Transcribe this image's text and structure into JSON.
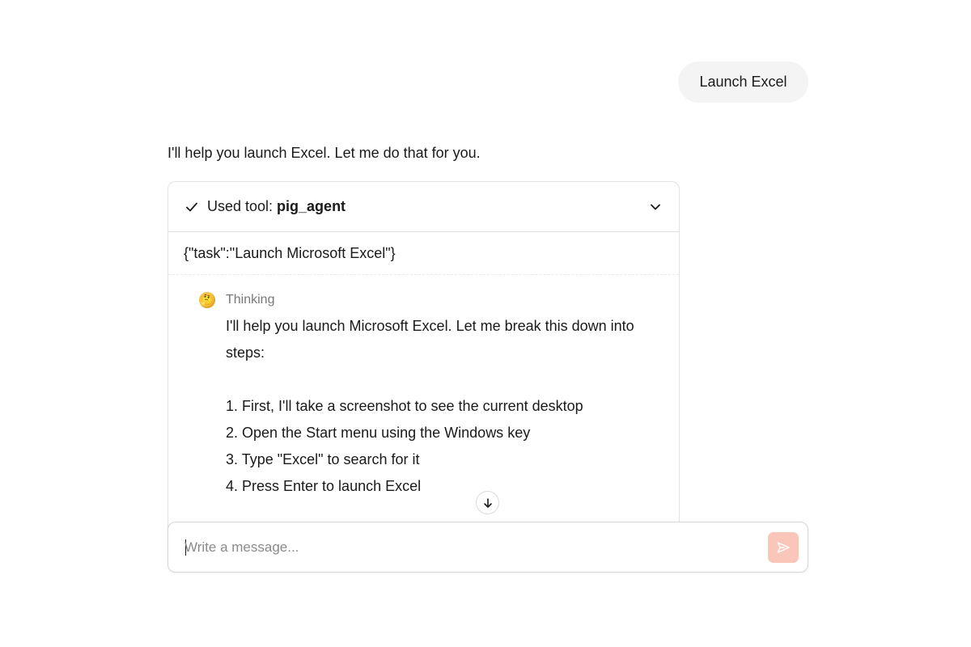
{
  "conversation": {
    "user_message": "Launch Excel",
    "assistant_message": "I'll help you launch Excel. Let me do that for you."
  },
  "tool_call": {
    "status_icon": "check-icon",
    "prefix": "Used tool:",
    "tool_name": "pig_agent",
    "arguments": "{\"task\":\"Launch Microsoft Excel\"}",
    "expand_icon": "chevron-down-icon"
  },
  "thinking": {
    "emoji": "🤔",
    "label": "Thinking",
    "intro": "I'll help you launch Microsoft Excel. Let me break this down into steps:",
    "steps": [
      "1. First, I'll take a screenshot to see the current desktop",
      "2. Open the Start menu using the Windows key",
      "3. Type \"Excel\" to search for it",
      "4. Press Enter to launch Excel"
    ]
  },
  "scroll_button": {
    "icon": "arrow-down-icon"
  },
  "composer": {
    "placeholder": "Write a message...",
    "value": "",
    "send_icon": "send-icon",
    "send_color": "#f9c6b9"
  }
}
